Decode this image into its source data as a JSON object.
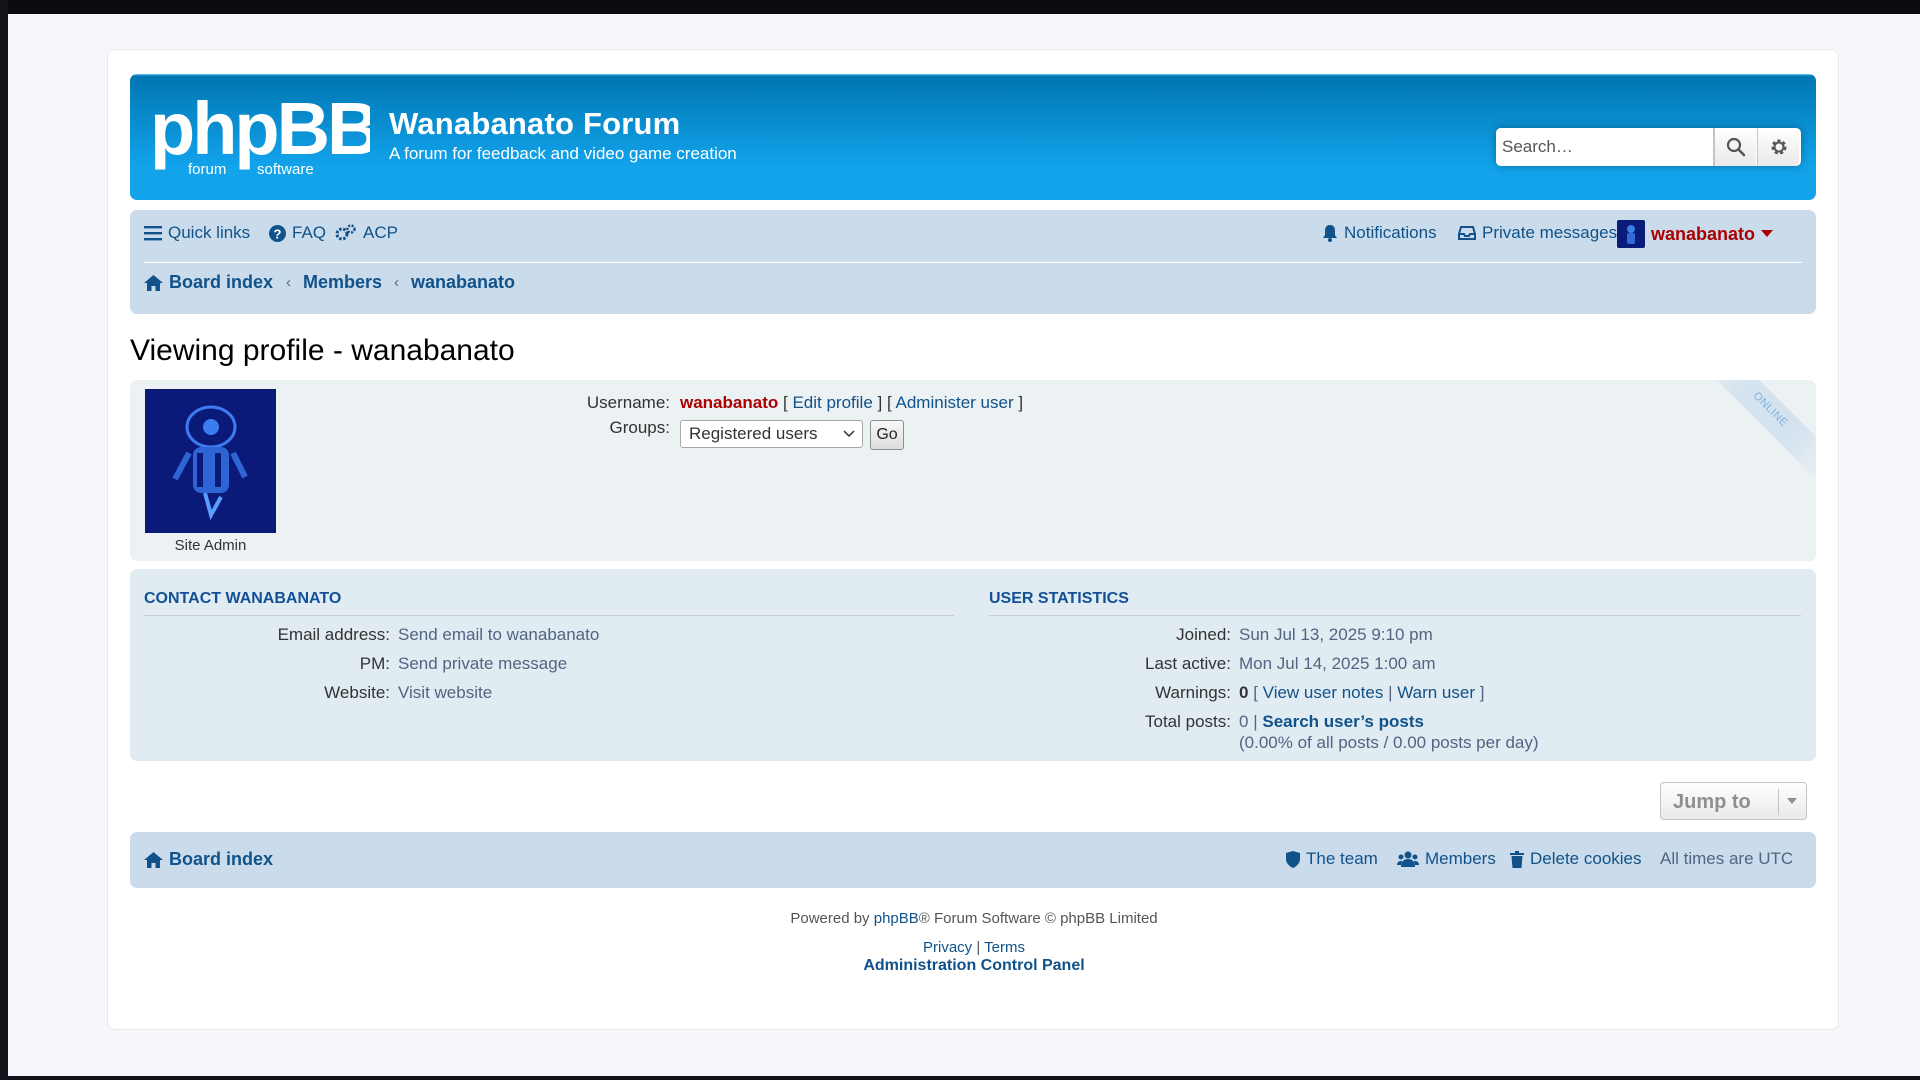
{
  "site": {
    "title": "Wanabanato Forum",
    "description": "A forum for feedback and video game creation",
    "logo_text": "phpBB",
    "logo_sub_left": "forum",
    "logo_sub_right": "software"
  },
  "search": {
    "placeholder": "Search…"
  },
  "nav": {
    "quick_links": "Quick links",
    "faq": "FAQ",
    "acp": "ACP",
    "notifications": "Notifications",
    "private_messages": "Private messages",
    "username": "wanabanato"
  },
  "breadcrumbs": [
    "Board index",
    "Members",
    "wanabanato"
  ],
  "page_title": "Viewing profile - wanabanato",
  "profile": {
    "rank": "Site Admin",
    "online_label": "ONLINE",
    "username_label": "Username:",
    "username": "wanabanato",
    "edit_profile": "Edit profile",
    "administer_user": "Administer user",
    "groups_label": "Groups:",
    "groups_selected": "Registered users",
    "go_label": "Go"
  },
  "contact": {
    "heading": "CONTACT WANABANATO",
    "rows": [
      {
        "label": "Email address:",
        "value": "Send email to wanabanato"
      },
      {
        "label": "PM:",
        "value": "Send private message"
      },
      {
        "label": "Website:",
        "value": "Visit website"
      }
    ]
  },
  "stats": {
    "heading": "USER STATISTICS",
    "joined_label": "Joined:",
    "joined": "Sun Jul 13, 2025 9:10 pm",
    "last_active_label": "Last active:",
    "last_active": "Mon Jul 14, 2025 1:00 am",
    "warnings_label": "Warnings:",
    "warnings": "0",
    "view_user_notes": "View user notes",
    "warn_user": "Warn user",
    "total_posts_label": "Total posts:",
    "total_posts": "0",
    "search_posts": "Search user’s posts",
    "posts_detail": "(0.00% of all posts / 0.00 posts per day)"
  },
  "jump_to": "Jump to",
  "footer_nav": {
    "board_index": "Board index",
    "the_team": "The team",
    "members": "Members",
    "delete_cookies": "Delete cookies",
    "timezone": "All times are UTC"
  },
  "footer": {
    "powered_by": "Powered by",
    "phpbb": "phpBB",
    "forum_software": "® Forum Software © phpBB Limited",
    "privacy": "Privacy",
    "terms": "Terms",
    "acp_link": "Administration Control Panel"
  },
  "colors": {
    "header_blue": "#12a3eb",
    "navbar": "#cadceb",
    "link": "#105289",
    "username": "#aa0000",
    "panel_light": "#ecf1f3",
    "panel_stats": "#e1ebf2"
  }
}
